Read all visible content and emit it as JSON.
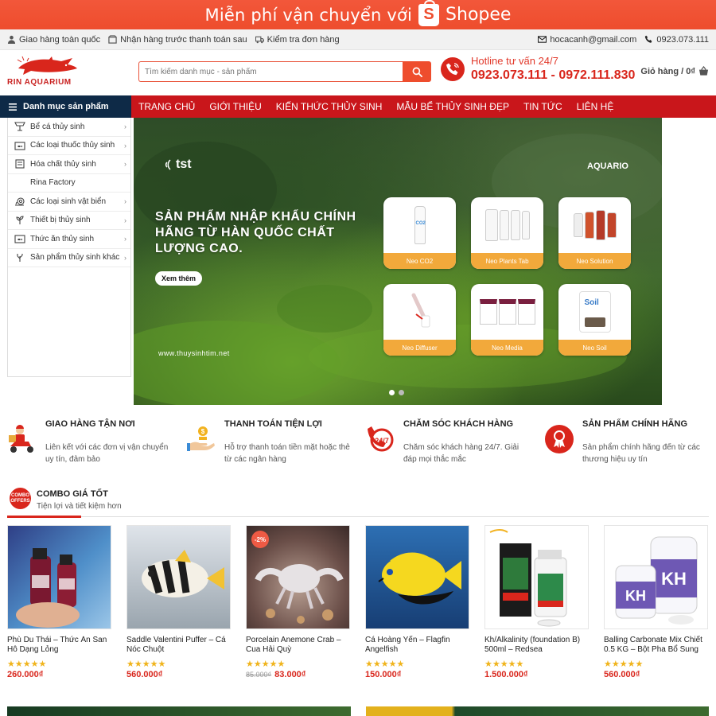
{
  "promo": {
    "text": "Miễn phí vận chuyển với",
    "brand": "Shopee",
    "bag_letter": "S"
  },
  "topbar": {
    "left": [
      "Giao hàng toàn quốc",
      "Nhận hàng trước thanh toán sau",
      "Kiểm tra đơn hàng"
    ],
    "email": "hocacanh@gmail.com",
    "phone": "0923.073.111"
  },
  "header": {
    "logo_text": "RIN AQUARIUM",
    "search_placeholder": "Tìm kiếm danh mục - sản phẩm",
    "hotline_title": "Hotline tư vấn 24/7",
    "hotline_numbers": "0923.073.111 - 0972.111.830",
    "cart_label": "Giỏ hàng / 0₫"
  },
  "nav": {
    "category_button": "Danh mục sản phẩm",
    "menu": [
      "TRANG CHỦ",
      "GIỚI THIỆU",
      "KIẾN THỨC THỦY SINH",
      "MẪU BỂ THỦY SINH ĐẸP",
      "TIN TỨC",
      "LIÊN HỆ"
    ]
  },
  "sidebar": {
    "items": [
      {
        "label": "Bể cá thủy sinh",
        "has_sub": true
      },
      {
        "label": "Các loại thuốc thủy sinh",
        "has_sub": true
      },
      {
        "label": "Hóa chất thủy sinh",
        "has_sub": true
      },
      {
        "label": "Rina Factory",
        "has_sub": false
      },
      {
        "label": "Các loại sinh vật biển",
        "has_sub": true
      },
      {
        "label": "Thiết bị thủy sinh",
        "has_sub": true
      },
      {
        "label": "Thức ăn thủy sinh",
        "has_sub": true
      },
      {
        "label": "Sản phẩm thủy sinh khác",
        "has_sub": true
      }
    ]
  },
  "slider": {
    "brand_left": "tst",
    "brand_right": "AQUARIO",
    "headline": "SẢN PHẨM NHẬP KHẨU CHÍNH HÃNG TỪ HÀN QUỐC CHẤT LƯỢNG CAO.",
    "button": "Xem thêm",
    "website": "www.thuysinhtim.net",
    "cards": [
      "Neo CO2",
      "Neo Plants Tab",
      "Neo Solution",
      "Neo Diffuser",
      "Neo Media",
      "Neo Soil"
    ],
    "active_slide": 1,
    "slide_count": 2
  },
  "features": [
    {
      "title": "GIAO HÀNG TẬN NƠI",
      "desc": "Liên kết với các đơn vị vận chuyển uy tín, đảm bảo"
    },
    {
      "title": "THANH TOÁN TIỆN LỢI",
      "desc": "Hỗ trợ thanh toán tiền mặt hoặc thẻ từ các ngân hàng"
    },
    {
      "title": "CHĂM SÓC KHÁCH HÀNG",
      "desc": "Chăm sóc khách hàng 24/7. Giải đáp mọi thắc mắc"
    },
    {
      "title": "SẢN PHẨM CHÍNH HÃNG",
      "desc": "Sản phẩm chính hãng đến từ các thương hiệu uy tín"
    }
  ],
  "combo": {
    "badge": "COMBO OFFERS",
    "title": "COMBO GIÁ TỐT",
    "subtitle": "Tiện lợi và tiết kiệm hơn"
  },
  "products": [
    {
      "name": "Phù Du Thái – Thức Ăn San Hô Dạng Lỏng",
      "rating": 5,
      "price": "260.000₫",
      "old_price": "",
      "sale": ""
    },
    {
      "name": "Saddle Valentini Puffer – Cá Nóc Chuột",
      "rating": 5,
      "price": "560.000₫",
      "old_price": "",
      "sale": ""
    },
    {
      "name": "Porcelain Anemone Crab – Cua Hải Quỳ",
      "rating": 5,
      "price": "83.000₫",
      "old_price": "85.000₫",
      "sale": "-2%"
    },
    {
      "name": "Cá Hoàng Yến – Flagfin Angelfish",
      "rating": 5,
      "price": "150.000₫",
      "old_price": "",
      "sale": ""
    },
    {
      "name": "Kh/Alkalinity (foundation B) 500ml – Redsea",
      "rating": 5,
      "price": "1.500.000₫",
      "old_price": "",
      "sale": ""
    },
    {
      "name": "Balling Carbonate Mix Chiết 0.5 KG – Bột Pha Bổ Sung KH",
      "rating": 5,
      "price": "560.000₫",
      "old_price": "",
      "sale": ""
    }
  ],
  "colors": {
    "brand_red": "#c9161b",
    "shopee_orange": "#ee4d2d",
    "dark_navy": "#0e2a47",
    "star": "#f0b41c"
  }
}
